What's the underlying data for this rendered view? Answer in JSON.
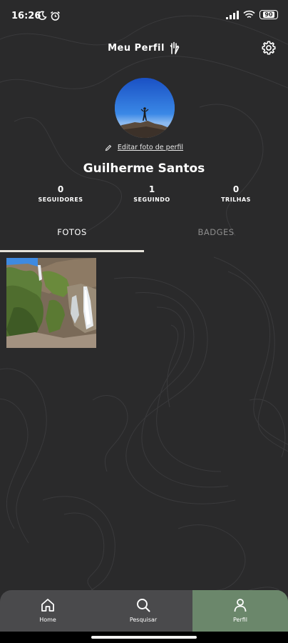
{
  "status_bar": {
    "time": "16:26",
    "battery": "90",
    "icons": [
      "moon-icon",
      "alarm-icon",
      "signal-icon",
      "wifi-icon",
      "battery-icon"
    ]
  },
  "header": {
    "title": "Meu Perfil",
    "title_icon": "hand-icon",
    "settings_icon": "gear-icon"
  },
  "profile": {
    "edit_photo_label": "Editar foto de perfil",
    "edit_icon": "pencil-icon",
    "name": "Guilherme Santos",
    "stats": [
      {
        "value": "0",
        "label": "SEGUIDORES"
      },
      {
        "value": "1",
        "label": "SEGUINDO"
      },
      {
        "value": "0",
        "label": "TRILHAS"
      }
    ]
  },
  "tabs": [
    {
      "label": "FOTOS",
      "active": true
    },
    {
      "label": "BADGES",
      "active": false
    }
  ],
  "photos_count": 1,
  "bottom_nav": [
    {
      "label": "Home",
      "icon": "home-icon",
      "active": false
    },
    {
      "label": "Pesquisar",
      "icon": "search-icon",
      "active": false
    },
    {
      "label": "Perfil",
      "icon": "user-icon",
      "active": true
    }
  ],
  "colors": {
    "background": "#2a2a2b",
    "nav_background": "#4a4a4c",
    "nav_active": "#6b876b",
    "tab_indicator": "#e6e3da",
    "tab_inactive_text": "#8d8d8d"
  }
}
